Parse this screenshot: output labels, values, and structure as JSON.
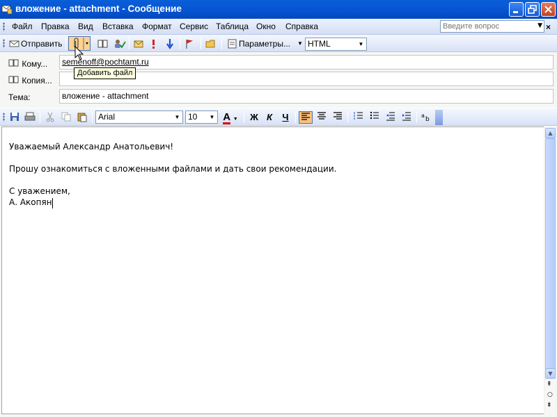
{
  "window": {
    "title": "вложение - attachment - Сообщение"
  },
  "menu": {
    "items": [
      "Файл",
      "Правка",
      "Вид",
      "Вставка",
      "Формат",
      "Сервис",
      "Таблица",
      "Окно",
      "Справка"
    ],
    "help_placeholder": "Введите вопрос"
  },
  "toolbar": {
    "send_label": "Отправить",
    "params_label": "Параметры...",
    "format_value": "HTML",
    "tooltip": "Добавить файл"
  },
  "header": {
    "to_label": "Кому...",
    "to_value": "semenoff@pochtamt.ru",
    "cc_label": "Копия...",
    "cc_value": "",
    "subject_label": "Тема:",
    "subject_value": "вложение - attachment"
  },
  "format": {
    "font": "Arial",
    "size": "10",
    "bold": "Ж",
    "italic": "К",
    "underline": "Ч",
    "font_color": "A",
    "accent": "#ffc17a"
  },
  "body": {
    "lines": [
      "Уважаемый Александр Анатольевич!",
      "Прошу ознакомиться с вложенными файлами и дать свои рекомендации.",
      "С уважением,",
      "А. Акопян"
    ]
  }
}
